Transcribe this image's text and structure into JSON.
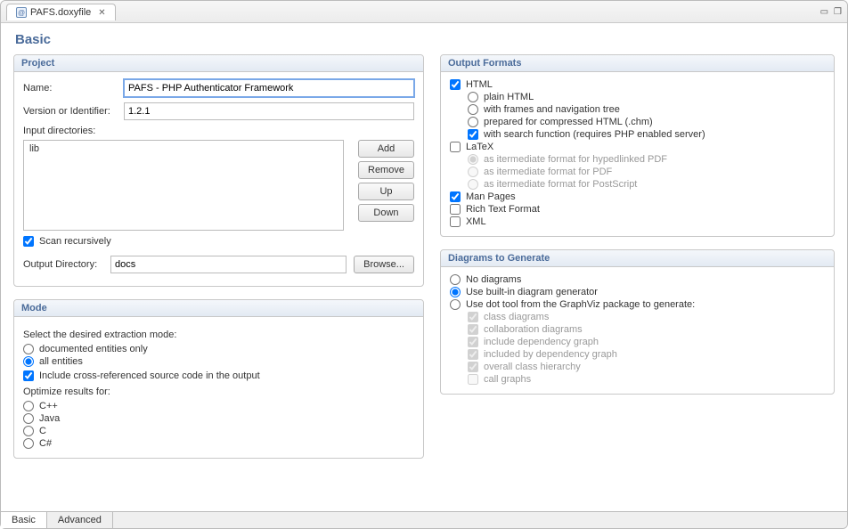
{
  "editor_tab": {
    "title": "PAFS.doxyfile"
  },
  "page_title": "Basic",
  "project": {
    "group_title": "Project",
    "name_label": "Name:",
    "name_value": "PAFS - PHP Authenticator Framework",
    "version_label": "Version or Identifier:",
    "version_value": "1.2.1",
    "input_dirs_label": "Input directories:",
    "input_dirs": [
      "lib"
    ],
    "buttons": {
      "add": "Add",
      "remove": "Remove",
      "up": "Up",
      "down": "Down"
    },
    "scan_recursively_label": "Scan recursively",
    "output_dir_label": "Output Directory:",
    "output_dir_value": "docs",
    "browse_label": "Browse..."
  },
  "mode": {
    "group_title": "Mode",
    "select_label": "Select the desired extraction mode:",
    "documented_only": "documented entities only",
    "all_entities": "all entities",
    "include_xref_label": "Include cross-referenced source code in the output",
    "optimize_label": "Optimize results for:",
    "langs": {
      "cpp": "C++",
      "java": "Java",
      "c": "C",
      "csharp": "C#"
    }
  },
  "formats": {
    "group_title": "Output Formats",
    "html": "HTML",
    "html_plain": "plain HTML",
    "html_frames": "with frames and navigation tree",
    "html_chm": "prepared for compressed HTML (.chm)",
    "html_search": "with search function (requires PHP enabled server)",
    "latex": "LaTeX",
    "latex_hyper": "as itermediate format for hypedlinked PDF",
    "latex_pdf": "as itermediate format for PDF",
    "latex_ps": "as itermediate format for PostScript",
    "man": "Man Pages",
    "rtf": "Rich Text Format",
    "xml": "XML"
  },
  "diagrams": {
    "group_title": "Diagrams to Generate",
    "none": "No diagrams",
    "builtin": "Use built-in diagram generator",
    "dot": "Use dot tool from the GraphViz package to generate:",
    "class": "class diagrams",
    "collab": "collaboration diagrams",
    "incdep": "include dependency graph",
    "incby": "included by dependency graph",
    "hierarchy": "overall class hierarchy",
    "call": "call graphs"
  },
  "bottom_tabs": {
    "basic": "Basic",
    "advanced": "Advanced"
  }
}
